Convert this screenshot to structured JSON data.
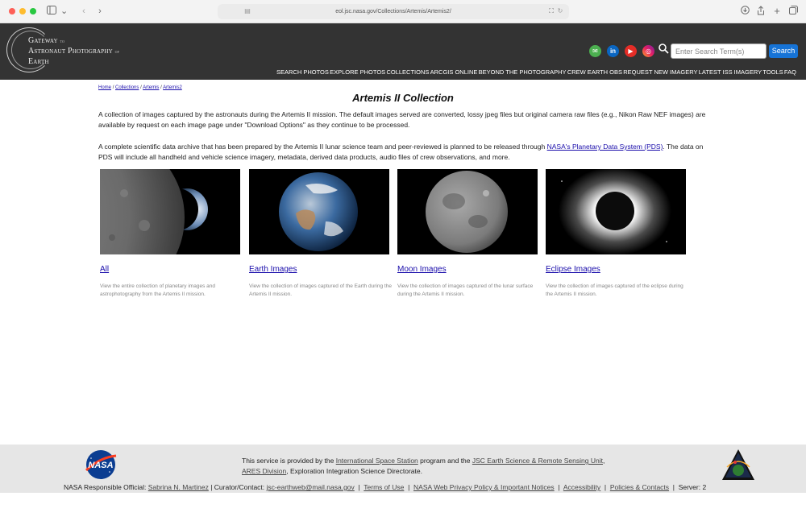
{
  "browser": {
    "url": "eol.jsc.nasa.gov/Collections/Artemis/Artemis2/"
  },
  "header": {
    "logo_lines": [
      "Gateway",
      "to",
      "Astronaut Photography",
      "of",
      "Earth"
    ],
    "social_icons": [
      "email-icon",
      "linkedin-icon",
      "youtube-icon",
      "instagram-icon"
    ],
    "search_placeholder": "Enter Search Term(s)",
    "search_button": "Search",
    "nav": [
      "SEARCH PHOTOS",
      "EXPLORE PHOTOS",
      "COLLECTIONS",
      "ARCGIS ONLINE",
      "BEYOND THE PHOTOGRAPHY",
      "CREW EARTH OBS",
      "REQUEST NEW IMAGERY",
      "LATEST ISS IMAGERY",
      "TOOLS",
      "FAQ"
    ]
  },
  "breadcrumb": [
    "Home",
    "Collections",
    "Artemis",
    "Artemis2"
  ],
  "page_title": "Artemis II Collection",
  "intro": {
    "p1": "A collection of images captured by the astronauts during the Artemis II mission. The default images served are converted, lossy jpeg files but original camera raw files (e.g., Nikon Raw NEF images) are available by request on each image page under \"Download Options\" as they continue to be processed.",
    "p2_before": "A complete scientific data archive that has been prepared by the Artemis II lunar science team and peer-reviewed is planned to be released through ",
    "p2_link": "NASA's Planetary Data System (PDS)",
    "p2_after": ". The data on PDS will include all handheld and vehicle science imagery, metadata, derived data products, audio files of crew observations, and more."
  },
  "cards": [
    {
      "title": "All",
      "desc": "View the entire collection of planetary images and astrophotography from the Artemis II mission."
    },
    {
      "title": "Earth Images",
      "desc": "View the collection of images captured of the Earth during the Artemis II mission."
    },
    {
      "title": "Moon Images",
      "desc": "View the collection of images captured of the lunar surface during the Artemis II mission."
    },
    {
      "title": "Eclipse Images",
      "desc": "View the collection of images captured of the eclipse during the Artemis II mission."
    }
  ],
  "footer": {
    "provided_prefix": "This service is provided by the ",
    "iss_link": "International Space Station",
    "provided_mid": " program and the ",
    "jsc_link": "JSC Earth Science & Remote Sensing Unit",
    "comma": ",",
    "ares_link": "ARES Division",
    "provided_suffix": ", Exploration Integration Science Directorate.",
    "official_label": "NASA Responsible Official: ",
    "official_name": "Sabrina N. Martinez",
    "curator_label": " |  Curator/Contact: ",
    "curator_email": "jsc-earthweb@mail.nasa.gov",
    "links": [
      "Terms of Use",
      "NASA Web Privacy Policy & Important Notices",
      "Accessibility",
      "Policies & Contacts"
    ],
    "server": "Server: 2",
    "nasa_logo_text": "NASA"
  }
}
